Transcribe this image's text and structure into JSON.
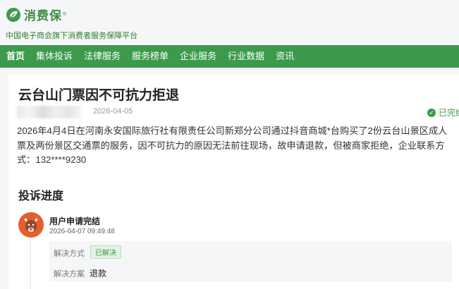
{
  "brand": {
    "name": "消费保",
    "reg_mark": "®",
    "tagline": "中国电子商会旗下消费者服务保障平台",
    "color": "#3c9a4b"
  },
  "nav": {
    "items": [
      {
        "label": "首页",
        "active": true
      },
      {
        "label": "集体投诉"
      },
      {
        "label": "法律服务"
      },
      {
        "label": "服务榜单"
      },
      {
        "label": "企业服务"
      },
      {
        "label": "行业数据"
      },
      {
        "label": "资讯"
      }
    ]
  },
  "complaint": {
    "title": "云台山门票因不可抗力拒退",
    "date": "2026-04-05",
    "status": "已完结",
    "status_icon": "check-circle-icon",
    "description": "2026年4月4日在河南永安国际旅行社有限责任公司新郑分公司通过抖音商城*台购买了2份云台山景区成人票及两份景区交通票的服务，因不可抗力的原因无法前往现场，故申请退款，但被商家拒绝，企业联系方式：132****9230"
  },
  "progress": {
    "section_title": "投诉进度",
    "events": [
      {
        "title": "用户申请完结",
        "time": "2026-04-07 09:49:48",
        "avatar_icon": "reindeer-avatar-icon",
        "method_label": "解决方式",
        "method_value": "已解决",
        "solution_label": "解决方案",
        "solution_value": "退款"
      }
    ]
  }
}
